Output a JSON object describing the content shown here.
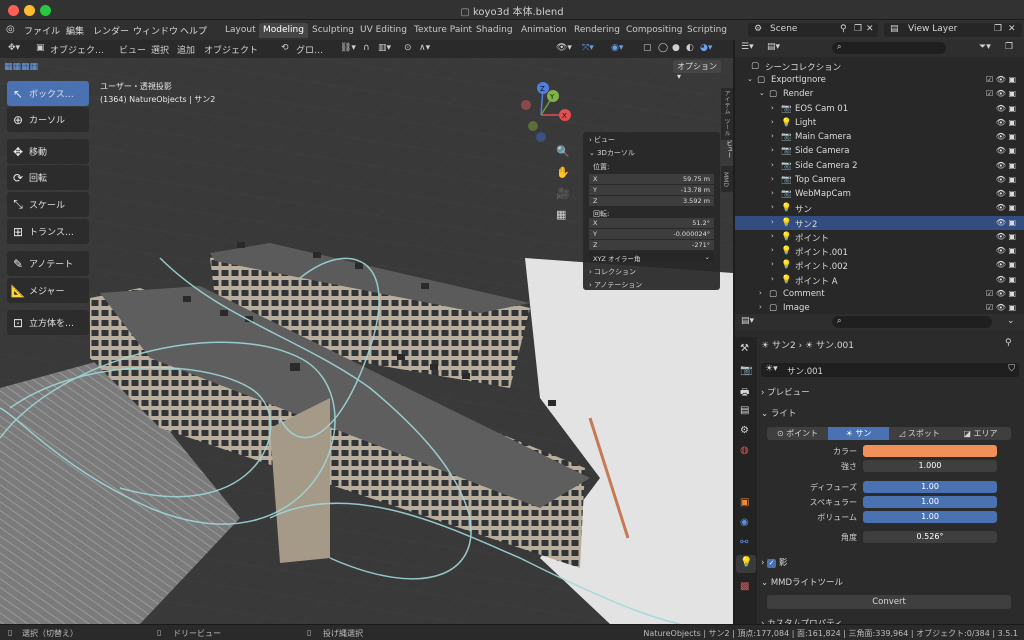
{
  "window": {
    "title": "koyo3d 本体.blend"
  },
  "menus": [
    "ファイル",
    "編集",
    "レンダー",
    "ウィンドウ",
    "ヘルプ"
  ],
  "workspaces": [
    "Layout",
    "Modeling",
    "Sculpting",
    "UV Editing",
    "Texture Paint",
    "Shading",
    "Animation",
    "Rendering",
    "Compositing",
    "Scripting"
  ],
  "active_workspace": "Modeling",
  "scene": {
    "name": "Scene",
    "view_layer": "View Layer"
  },
  "viewport_header": {
    "mode": "オブジェク…",
    "view": "ビュー",
    "select": "選択",
    "add": "追加",
    "object": "オブジェクト",
    "transform": "グロ…",
    "options": "オプション"
  },
  "viewport_info": {
    "view_name": "ユーザー・透視投影",
    "context": "(1364) NatureObjects | サン2"
  },
  "tools": [
    "ボックス…",
    "カーソル",
    "移動",
    "回転",
    "スケール",
    "トランス…",
    "アノテート",
    "メジャー",
    "立方体を…"
  ],
  "npanel": {
    "tabs": [
      "アイテム",
      "ツール",
      "ビュー",
      "MMD"
    ],
    "view_header": "ビュー",
    "cursor_header": "3Dカーソル",
    "location_label": "位置:",
    "location": [
      {
        "axis": "X",
        "value": "59.75 m"
      },
      {
        "axis": "Y",
        "value": "-13.78 m"
      },
      {
        "axis": "Z",
        "value": "3.592 m"
      }
    ],
    "rotation_label": "回転:",
    "rotation": [
      {
        "axis": "X",
        "value": "51.2°"
      },
      {
        "axis": "Y",
        "value": "-0.000024°"
      },
      {
        "axis": "Z",
        "value": "-271°"
      }
    ],
    "rotation_mode": "XYZ オイラー角",
    "collection_header": "コレクション",
    "annotation_header": "アノテーション"
  },
  "outliner": {
    "root": "シーンコレクション",
    "rows": [
      {
        "label": "ExportIgnore",
        "level": 1
      },
      {
        "label": "Render",
        "level": 2
      },
      {
        "label": "EOS Cam 01",
        "level": 3
      },
      {
        "label": "Light",
        "level": 3
      },
      {
        "label": "Main Camera",
        "level": 3
      },
      {
        "label": "Side Camera",
        "level": 3
      },
      {
        "label": "Side Camera 2",
        "level": 3
      },
      {
        "label": "Top Camera",
        "level": 3
      },
      {
        "label": "WebMapCam",
        "level": 3
      },
      {
        "label": "サン",
        "level": 3
      },
      {
        "label": "サン2",
        "level": 3,
        "selected": true
      },
      {
        "label": "ポイント",
        "level": 3
      },
      {
        "label": "ポイント.001",
        "level": 3
      },
      {
        "label": "ポイント.002",
        "level": 3
      },
      {
        "label": "ポイント A",
        "level": 3
      },
      {
        "label": "Comment",
        "level": 2
      },
      {
        "label": "Image",
        "level": 2
      }
    ],
    "comment_badge": "9",
    "image_badge": "5"
  },
  "properties": {
    "breadcrumb_object": "サン2",
    "breadcrumb_data": "サン.001",
    "datablock": "サン.001",
    "preview_header": "プレビュー",
    "light_header": "ライト",
    "light_types": [
      "ポイント",
      "サン",
      "スポット",
      "エリア"
    ],
    "active_light_type": "サン",
    "fields": [
      {
        "label": "カラー",
        "value": "",
        "kind": "color"
      },
      {
        "label": "強さ",
        "value": "1.000",
        "kind": "num"
      },
      {
        "label": "ディフューズ",
        "value": "1.00",
        "kind": "slider"
      },
      {
        "label": "スペキュラー",
        "value": "1.00",
        "kind": "slider"
      },
      {
        "label": "ボリューム",
        "value": "1.00",
        "kind": "slider"
      },
      {
        "label": "角度",
        "value": "0.526°",
        "kind": "num"
      }
    ],
    "light_color": "#f2905a",
    "shadow_header": "影",
    "mmd_header": "MMDライトツール",
    "convert_label": "Convert",
    "custom_header": "カスタムプロパティ"
  },
  "statusbar": {
    "left1": "選択（切替え）",
    "left2": "ドリービュー",
    "left3": "投げ縄選択",
    "stats": "NatureObjects | サン2 | 頂点:177,084 | 面:161,824 | 三角面:339,964 | オブジェクト:0/384 | 3.5.1"
  }
}
